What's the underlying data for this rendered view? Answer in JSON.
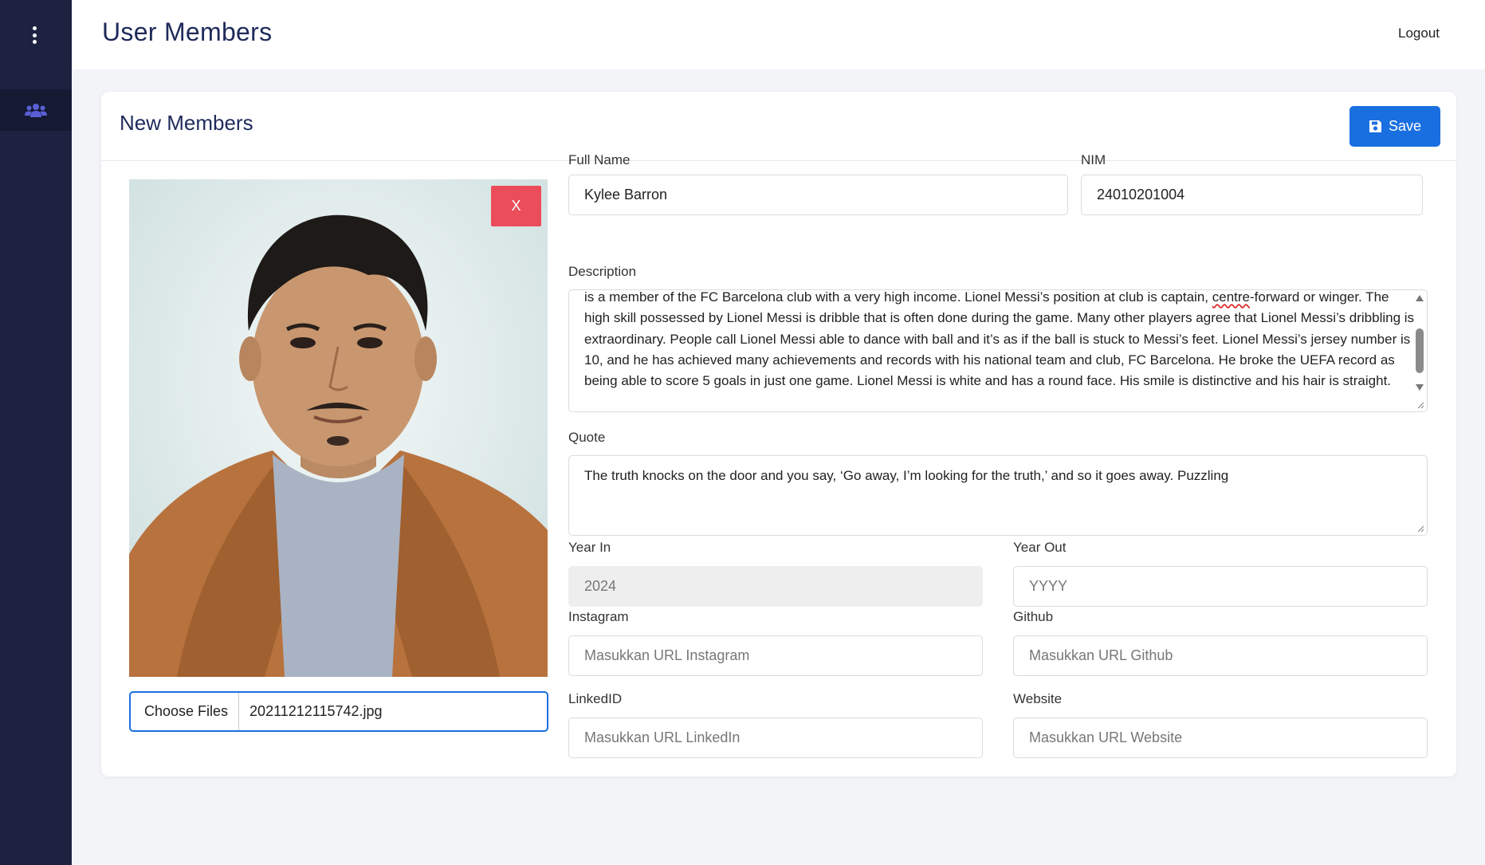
{
  "sidebar": {
    "menu_icon": "kebab-vertical-icon",
    "nav_icon": "users-icon",
    "accent": "#5b5fd6"
  },
  "header": {
    "title": "User Members",
    "logout_label": "Logout"
  },
  "card": {
    "title": "New Members",
    "save_label": "Save",
    "save_icon": "floppy-disk-icon",
    "remove_photo_label": "X"
  },
  "file_input": {
    "button_label": "Choose Files",
    "file_name": "20211212115742.jpg"
  },
  "form": {
    "full_name": {
      "label": "Full Name",
      "value": "Kylee Barron"
    },
    "nim": {
      "label": "NIM",
      "value": "24010201004"
    },
    "description": {
      "label": "Description",
      "line1_before": "is a member of the FC Barcelona club with a very high income. Lionel Messi’s position at club is captain, ",
      "line1_misspelled": "centre",
      "line1_after": "-forward or",
      "rest": "winger. The high skill possessed by Lionel Messi is dribble that is often done during the game. Many other players agree that Lionel Messi’s dribbling is extraordinary. People call Lionel Messi able to dance with ball and it’s as if the ball is stuck to Messi’s feet. Lionel Messi’s jersey number is 10, and he has achieved many achievements and records with his national team and club, FC Barcelona. He broke the UEFA record as being able to score 5 goals in just one game. Lionel Messi is white and has a round face. His smile is distinctive and his hair is straight."
    },
    "quote": {
      "label": "Quote",
      "value": "The truth knocks on the door and you say, ‘Go away, I’m looking for the truth,’ and so it goes away. Puzzling"
    },
    "year_in": {
      "label": "Year In",
      "value": "2024"
    },
    "year_out": {
      "label": "Year Out",
      "placeholder": "YYYY"
    },
    "instagram": {
      "label": "Instagram",
      "placeholder": "Masukkan URL Instagram"
    },
    "github": {
      "label": "Github",
      "placeholder": "Masukkan URL Github"
    },
    "linkedin": {
      "label": "LinkedID",
      "placeholder": "Masukkan URL LinkedIn"
    },
    "website": {
      "label": "Website",
      "placeholder": "Masukkan URL Website"
    }
  },
  "colors": {
    "sidebar_bg": "#1c2240",
    "primary": "#1a6fe0",
    "danger": "#eb4d5b",
    "title": "#1f2a5a"
  }
}
